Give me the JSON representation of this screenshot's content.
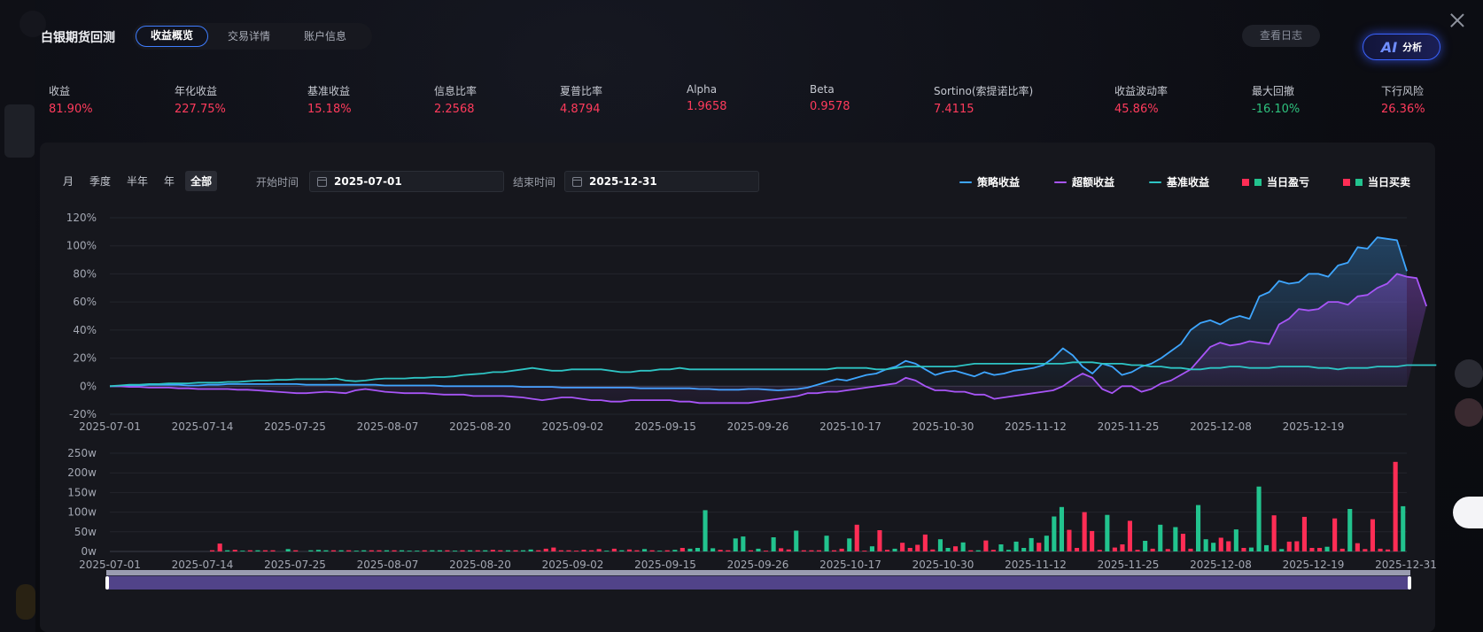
{
  "app": {
    "title": "白银期货回测"
  },
  "tabs": [
    {
      "label": "收益概览",
      "active": true
    },
    {
      "label": "交易详情",
      "active": false
    },
    {
      "label": "账户信息",
      "active": false
    }
  ],
  "header": {
    "log_label": "查看日志",
    "ai_mark": "AI",
    "ai_label": "分析"
  },
  "stats": [
    {
      "label": "收益",
      "value": "81.90%",
      "color": "#ff3b5c"
    },
    {
      "label": "年化收益",
      "value": "227.75%",
      "color": "#ff3b5c"
    },
    {
      "label": "基准收益",
      "value": "15.18%",
      "color": "#ff3b5c"
    },
    {
      "label": "信息比率",
      "value": "2.2568",
      "color": "#ff3b5c"
    },
    {
      "label": "夏普比率",
      "value": "4.8794",
      "color": "#ff3b5c"
    },
    {
      "label": "Alpha",
      "value": "1.9658",
      "color": "#ff3b5c"
    },
    {
      "label": "Beta",
      "value": "0.9578",
      "color": "#ff3b5c"
    },
    {
      "label": "Sortino(索提诺比率)",
      "value": "7.4115",
      "color": "#ff3b5c"
    },
    {
      "label": "收益波动率",
      "value": "45.86%",
      "color": "#ff3b5c"
    },
    {
      "label": "最大回撤",
      "value": "-16.10%",
      "color": "#2ec27e"
    },
    {
      "label": "下行风险",
      "value": "26.36%",
      "color": "#ff3b5c"
    }
  ],
  "filters": {
    "periods": [
      {
        "label": "月",
        "active": false
      },
      {
        "label": "季度",
        "active": false
      },
      {
        "label": "半年",
        "active": false
      },
      {
        "label": "年",
        "active": false
      },
      {
        "label": "全部",
        "active": true
      }
    ],
    "start_label": "开始时间",
    "start_value": "2025-07-01",
    "end_label": "结束时间",
    "end_value": "2025-12-31"
  },
  "legend": [
    {
      "label": "策略收益",
      "kind": "line",
      "colors": [
        "#3ea6ff"
      ]
    },
    {
      "label": "超额收益",
      "kind": "line",
      "colors": [
        "#a855f7"
      ]
    },
    {
      "label": "基准收益",
      "kind": "line",
      "colors": [
        "#2ec4c4"
      ]
    },
    {
      "label": "当日盈亏",
      "kind": "bar",
      "colors": [
        "#ff2d55",
        "#22c38e"
      ]
    },
    {
      "label": "当日买卖",
      "kind": "bar",
      "colors": [
        "#ff2d55",
        "#22c38e"
      ]
    }
  ],
  "chart_data": [
    {
      "type": "line",
      "x_ticks": [
        "2025-07-01",
        "2025-07-14",
        "2025-07-25",
        "2025-08-07",
        "2025-08-20",
        "2025-09-02",
        "2025-09-15",
        "2025-09-26",
        "2025-10-17",
        "2025-10-30",
        "2025-11-12",
        "2025-11-25",
        "2025-12-08",
        "2025-12-19"
      ],
      "ylim": [
        -20,
        120
      ],
      "y_ticks": [
        "120%",
        "100%",
        "80%",
        "60%",
        "40%",
        "20%",
        "0%",
        "-20%"
      ],
      "y_unit": "%",
      "series": [
        {
          "name": "策略收益",
          "color": "#3ea6ff",
          "fill": true,
          "values": [
            0,
            0,
            0.5,
            0.5,
            1,
            1,
            1,
            1,
            0.5,
            0.5,
            1,
            1,
            1.5,
            1.5,
            1.5,
            1.5,
            1.5,
            1.5,
            1.5,
            1.5,
            1,
            1,
            1,
            1,
            1,
            1,
            1,
            1,
            0.5,
            0.5,
            0.5,
            0.5,
            0.5,
            0.5,
            0,
            0,
            0,
            0,
            0,
            0,
            0,
            0,
            -0.5,
            -0.5,
            -0.5,
            -0.5,
            -1,
            -1,
            -1,
            -1,
            -1,
            -1,
            -1,
            -1,
            -1.5,
            -1.5,
            -1.5,
            -1.5,
            -1.5,
            -1.5,
            -2,
            -2,
            -2.5,
            -2.5,
            -2.5,
            -2,
            -2,
            -2.5,
            -3,
            -2.5,
            -2,
            -1,
            1,
            3,
            5,
            4,
            6,
            8,
            9,
            12,
            14,
            18,
            16,
            12,
            8,
            10,
            11,
            9,
            7,
            10,
            8,
            9,
            11,
            12,
            13,
            15,
            20,
            27,
            22,
            14,
            9,
            16,
            14,
            8,
            10,
            14,
            16,
            20,
            25,
            30,
            40,
            45,
            47,
            44,
            48,
            50,
            48,
            64,
            67,
            75,
            73,
            74,
            80,
            80,
            78,
            86,
            88,
            99,
            98,
            106,
            105,
            104,
            82
          ]
        },
        {
          "name": "超额收益",
          "color": "#a855f7",
          "fill": true,
          "values": [
            0,
            0,
            -0.5,
            -0.5,
            -1,
            -1,
            -1,
            -1.5,
            -1.5,
            -2,
            -2,
            -2,
            -2,
            -2.5,
            -2.5,
            -3,
            -3.5,
            -4,
            -4.5,
            -5,
            -5,
            -4.5,
            -4,
            -4.5,
            -5,
            -3,
            -2,
            -3,
            -4,
            -4.5,
            -5,
            -5,
            -5,
            -5.5,
            -6,
            -6,
            -6,
            -7,
            -7,
            -7,
            -7,
            -7.5,
            -8,
            -9,
            -10,
            -9,
            -8,
            -8,
            -9,
            -10,
            -10,
            -11,
            -11,
            -10,
            -10,
            -10,
            -10,
            -10,
            -11,
            -11,
            -12,
            -12,
            -12,
            -12,
            -12,
            -12,
            -11,
            -10,
            -9,
            -8,
            -7,
            -5,
            -5,
            -4,
            -4,
            -3,
            -2,
            -1,
            0,
            1,
            2,
            6,
            4,
            0,
            -3,
            -3,
            -4,
            -4,
            -6,
            -6,
            -9,
            -8,
            -7,
            -6,
            -5,
            -4,
            -3,
            0,
            5,
            9,
            6,
            -2,
            -5,
            0,
            0,
            -4,
            -2,
            2,
            4,
            8,
            12,
            20,
            28,
            31,
            29,
            30,
            32,
            31,
            30,
            44,
            48,
            55,
            54,
            55,
            60,
            60,
            58,
            64,
            65,
            70,
            73,
            80,
            78,
            77,
            57
          ]
        },
        {
          "name": "基准收益",
          "color": "#2ec4c4",
          "fill": false,
          "values": [
            0,
            0.5,
            1,
            1,
            1.5,
            1.5,
            2,
            2,
            2,
            2.5,
            2.5,
            2.5,
            3,
            3,
            3.5,
            4,
            4,
            4.5,
            4.5,
            5,
            5,
            5,
            5,
            5.5,
            4,
            3.5,
            4,
            5,
            5.5,
            5.5,
            5.5,
            6,
            6,
            6.5,
            6.5,
            7,
            8,
            8.5,
            9,
            10,
            10,
            11,
            12,
            13,
            12,
            11,
            11,
            12,
            12,
            12,
            12,
            11,
            10,
            10,
            11,
            11,
            12,
            12,
            13,
            12,
            12,
            12,
            12,
            12,
            12,
            12,
            12,
            12,
            12,
            12,
            12,
            12,
            12,
            12,
            13,
            13,
            13,
            13,
            12,
            12,
            13,
            14,
            14,
            14,
            14,
            14,
            14,
            15,
            16,
            16,
            16,
            16,
            16,
            16,
            16,
            16,
            16,
            16,
            17,
            17,
            17,
            16,
            16,
            16,
            15,
            15,
            14,
            14,
            13,
            13,
            12,
            12,
            13,
            13,
            14,
            14,
            13,
            13,
            13,
            14,
            14,
            14,
            14,
            13,
            13,
            12,
            13,
            13,
            13,
            14,
            14,
            14,
            15,
            15,
            15,
            15
          ]
        }
      ]
    },
    {
      "type": "bar",
      "x_ticks": [
        "2025-07-01",
        "2025-07-14",
        "2025-07-25",
        "2025-08-07",
        "2025-08-20",
        "2025-09-02",
        "2025-09-15",
        "2025-09-26",
        "2025-10-17",
        "2025-10-30",
        "2025-11-12",
        "2025-11-25",
        "2025-12-08",
        "2025-12-19",
        "2025-12-31"
      ],
      "ylim": [
        0,
        250
      ],
      "y_ticks": [
        "250w",
        "200w",
        "150w",
        "100w",
        "50w",
        "0w"
      ],
      "y_unit": "w",
      "values": [
        0,
        0,
        0,
        0,
        0,
        0,
        0,
        0,
        0,
        0,
        0,
        0,
        0,
        -3,
        -20,
        3,
        -4,
        2,
        -3,
        3,
        -3,
        -3,
        0,
        6,
        -3,
        0,
        3,
        4,
        3,
        -3,
        3,
        -3,
        2,
        3,
        -3,
        -3,
        3,
        -3,
        3,
        2,
        2,
        -3,
        3,
        3,
        -3,
        2,
        -3,
        3,
        -3,
        3,
        -4,
        -3,
        3,
        -3,
        3,
        5,
        -3,
        -7,
        -10,
        -3,
        -3,
        -2,
        -4,
        -3,
        -6,
        2,
        -7,
        3,
        -5,
        -3,
        6,
        -3,
        2,
        -3,
        4,
        -9,
        7,
        9,
        105,
        8,
        -4,
        -3,
        33,
        38,
        -3,
        7,
        -2,
        36,
        -8,
        -5,
        53,
        -3,
        -3,
        -3,
        40,
        -3,
        -7,
        33,
        -68,
        -2,
        13,
        -54,
        -4,
        7,
        -22,
        -9,
        -17,
        -43,
        -5,
        31,
        9,
        -13,
        23,
        -3,
        3,
        -28,
        -4,
        18,
        4,
        25,
        9,
        34,
        -22,
        40,
        89,
        113,
        -55,
        -9,
        -100,
        -52,
        -4,
        93,
        -10,
        -18,
        -78,
        -4,
        27,
        -7,
        68,
        -6,
        62,
        -45,
        -7,
        118,
        31,
        22,
        -35,
        -26,
        56,
        -9,
        10,
        165,
        16,
        -92,
        6,
        -25,
        -26,
        -88,
        -9,
        -9,
        12,
        -84,
        -7,
        108,
        -21,
        -6,
        -82,
        -7,
        -5,
        -228,
        115
      ]
    }
  ]
}
